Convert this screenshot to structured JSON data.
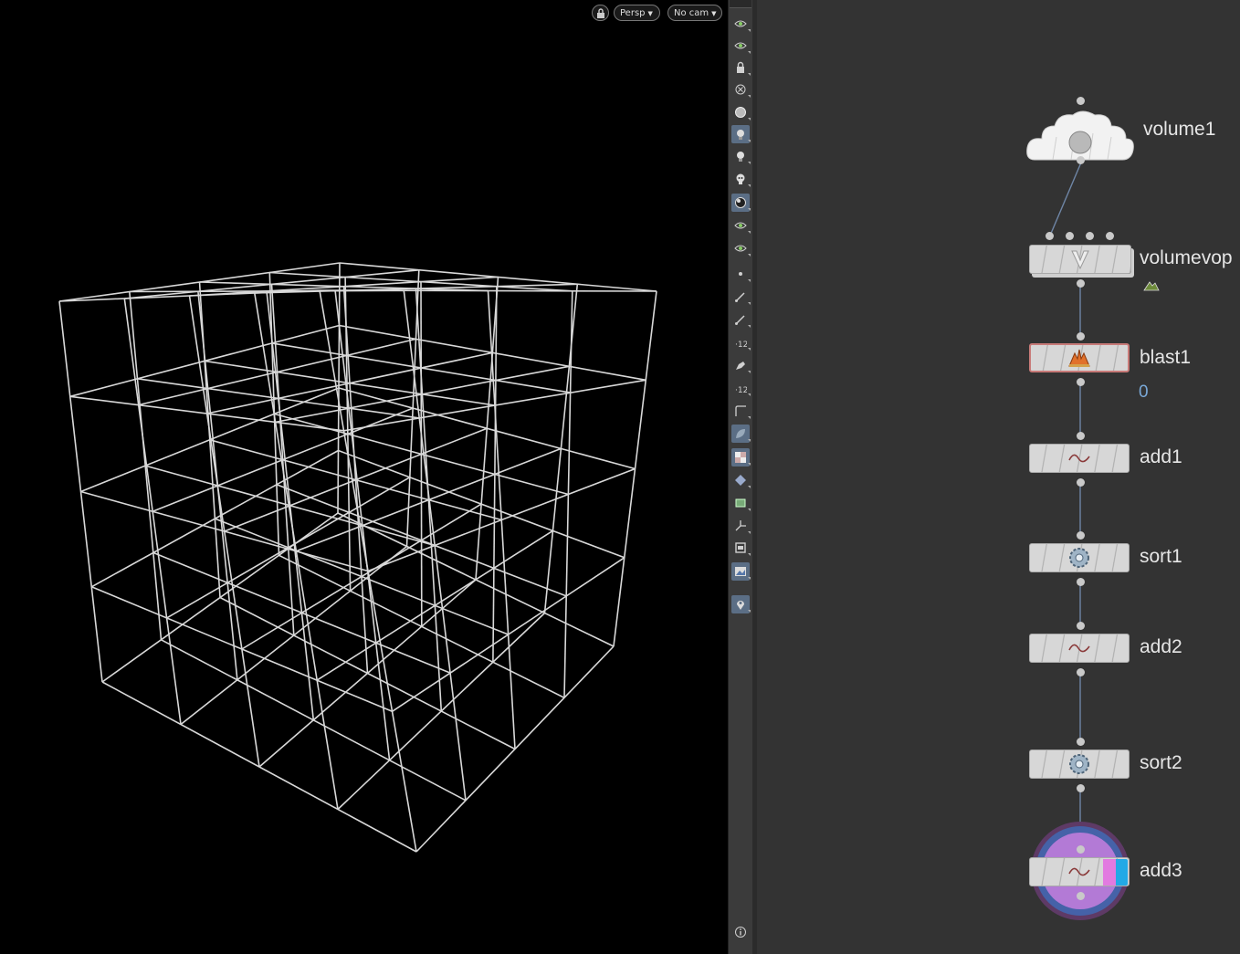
{
  "viewport": {
    "view_menu": "Persp",
    "camera_menu": "No cam"
  },
  "toolbar": {
    "tools": [
      {
        "icon": "display-options-icon",
        "active": false
      },
      {
        "icon": "ghost-geometry-icon",
        "active": false
      },
      {
        "icon": "lock-camera-icon",
        "active": false
      },
      {
        "icon": "hide-other-objects-icon",
        "active": false
      },
      {
        "icon": "shading-mode-icon",
        "active": false
      },
      {
        "icon": "light-bulb-icon",
        "active": true
      },
      {
        "icon": "headlight-icon",
        "active": false
      },
      {
        "icon": "skull-icon",
        "active": false
      },
      {
        "icon": "smooth-shaded-icon",
        "active": true
      },
      {
        "icon": "visualizer-icon",
        "active": false
      },
      {
        "icon": "visualizer-scene-icon",
        "active": false
      },
      {
        "icon": "point-display-icon",
        "active": false
      },
      {
        "icon": "point-normals-icon",
        "active": false
      },
      {
        "icon": "point-velocity-icon",
        "active": false
      },
      {
        "icon": "point-numbers-icon",
        "active": false
      },
      {
        "icon": "prim-normals-icon",
        "active": false
      },
      {
        "icon": "prim-numbers-icon",
        "active": false
      },
      {
        "icon": "uv-border-icon",
        "active": false
      },
      {
        "icon": "template-geometry-icon",
        "active": true
      },
      {
        "icon": "backface-cull-icon",
        "active": true
      },
      {
        "icon": "display-guides-icon",
        "active": false
      },
      {
        "icon": "bounding-box-icon",
        "active": false
      },
      {
        "icon": "origin-axes-icon",
        "active": false
      },
      {
        "icon": "safe-area-icon",
        "active": false
      },
      {
        "icon": "background-image-icon",
        "active": true
      },
      {
        "icon": "viewport-snapshot-icon",
        "active": true
      },
      {
        "icon": "info-icon",
        "active": false
      }
    ]
  },
  "network": {
    "nodes": [
      {
        "id": "volume1",
        "label": "volume1"
      },
      {
        "id": "volumevop1",
        "label": "volumevop"
      },
      {
        "id": "blast1",
        "label": "blast1",
        "stat": "0"
      },
      {
        "id": "add1",
        "label": "add1"
      },
      {
        "id": "sort1",
        "label": "sort1"
      },
      {
        "id": "add2",
        "label": "add2"
      },
      {
        "id": "sort2",
        "label": "sort2"
      },
      {
        "id": "add3",
        "label": "add3"
      }
    ]
  }
}
